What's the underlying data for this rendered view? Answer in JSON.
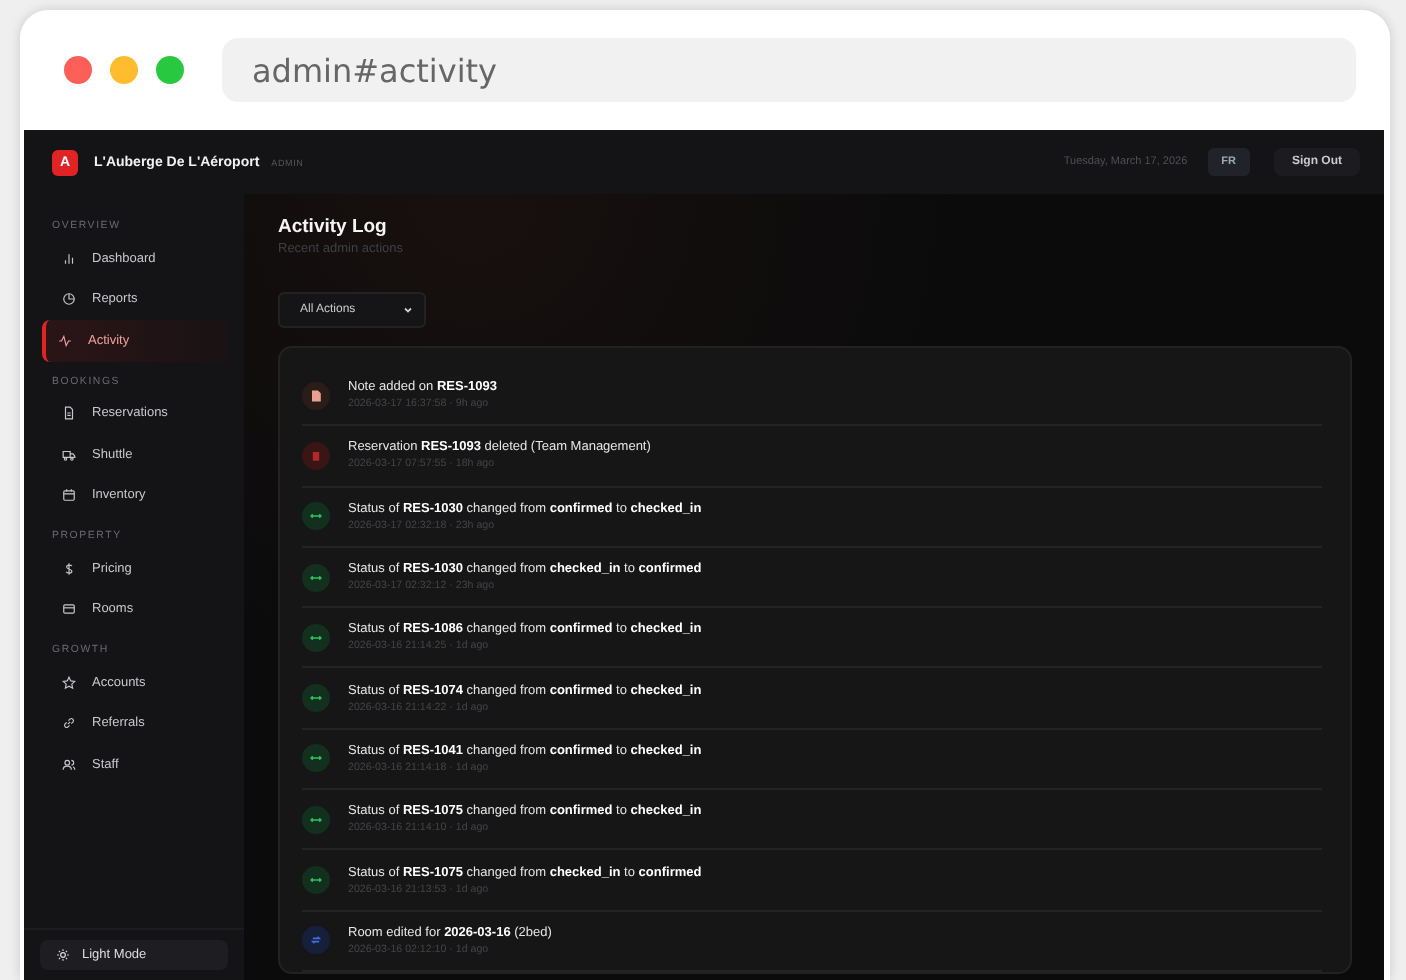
{
  "browser": {
    "url": "admin#activity"
  },
  "header": {
    "logo": "A",
    "brand": "L'Auberge De L'Aéroport",
    "role": "ADMIN",
    "date": "Tuesday, March 17, 2026",
    "language": "FR",
    "sign_out": "Sign Out"
  },
  "sidebar": {
    "sections": [
      {
        "label": "OVERVIEW",
        "items": [
          {
            "label": "Dashboard",
            "kind": "bars",
            "selected": false
          },
          {
            "label": "Reports",
            "kind": "pie",
            "selected": false
          },
          {
            "label": "Activity",
            "kind": "pulse",
            "selected": true
          }
        ]
      },
      {
        "label": "BOOKINGS",
        "items": [
          {
            "label": "Reservations",
            "kind": "doc",
            "selected": false
          },
          {
            "label": "Shuttle",
            "kind": "truck",
            "selected": false
          },
          {
            "label": "Inventory",
            "kind": "calendar",
            "selected": false
          }
        ]
      },
      {
        "label": "PROPERTY",
        "items": [
          {
            "label": "Pricing",
            "kind": "dollar",
            "selected": false
          },
          {
            "label": "Rooms",
            "kind": "bed",
            "selected": false
          }
        ]
      },
      {
        "label": "GROWTH",
        "items": [
          {
            "label": "Accounts",
            "kind": "star",
            "selected": false
          },
          {
            "label": "Referrals",
            "kind": "link",
            "selected": false
          },
          {
            "label": "Staff",
            "kind": "users",
            "selected": false
          }
        ]
      }
    ],
    "theme_toggle": "Light Mode"
  },
  "page": {
    "title": "Activity Log",
    "subtitle": "Recent admin actions",
    "filter": "All Actions"
  },
  "activity": [
    {
      "kind": "note",
      "text": "Note added on **RES-1093**",
      "time": "2026-03-17 16:37:58 · 9h ago"
    },
    {
      "kind": "delete",
      "text": "Reservation **RES-1093** deleted (Team Management)",
      "time": "2026-03-17 07:57:55 · 18h ago"
    },
    {
      "kind": "status",
      "text": "Status of **RES-1030** changed from **confirmed** to **checked_in**",
      "time": "2026-03-17 02:32:18 · 23h ago"
    },
    {
      "kind": "status",
      "text": "Status of **RES-1030** changed from **checked_in** to **confirmed**",
      "time": "2026-03-17 02:32:12 · 23h ago"
    },
    {
      "kind": "status",
      "text": "Status of **RES-1086** changed from **confirmed** to **checked_in**",
      "time": "2026-03-16 21:14:25 · 1d ago"
    },
    {
      "kind": "status",
      "text": "Status of **RES-1074** changed from **confirmed** to **checked_in**",
      "time": "2026-03-16 21:14:22 · 1d ago"
    },
    {
      "kind": "status",
      "text": "Status of **RES-1041** changed from **confirmed** to **checked_in**",
      "time": "2026-03-16 21:14:18 · 1d ago"
    },
    {
      "kind": "status",
      "text": "Status of **RES-1075** changed from **confirmed** to **checked_in**",
      "time": "2026-03-16 21:14:10 · 1d ago"
    },
    {
      "kind": "status",
      "text": "Status of **RES-1075** changed from **checked_in** to **confirmed**",
      "time": "2026-03-16 21:13:53 · 1d ago"
    },
    {
      "kind": "room",
      "text": "Room edited for **2026-03-16** (2bed)",
      "time": "2026-03-16 02:12:10 · 1d ago"
    }
  ]
}
